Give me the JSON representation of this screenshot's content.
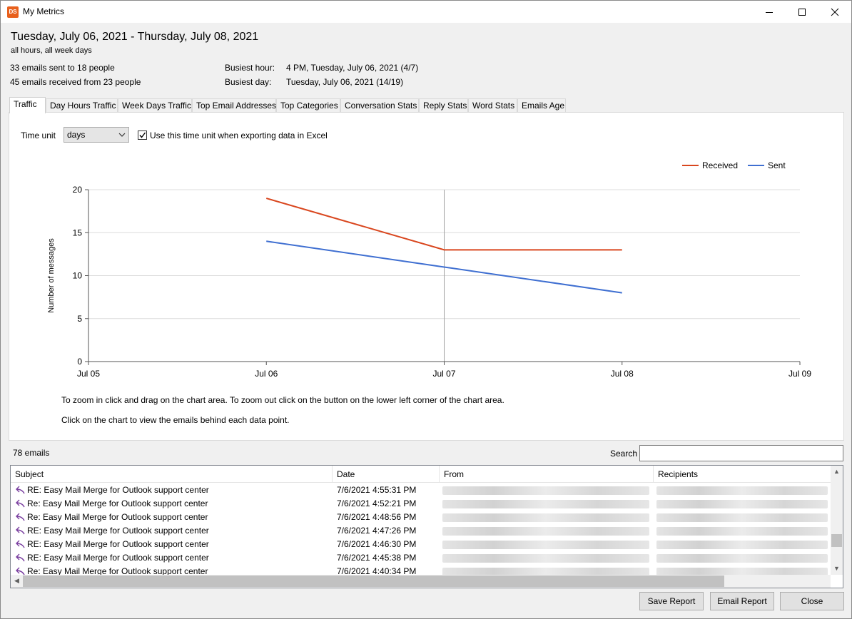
{
  "window": {
    "app_icon_text": "DS",
    "title": "My Metrics"
  },
  "header": {
    "date_range": "Tuesday, July 06, 2021 - Thursday, July 08, 2021",
    "filter": "all hours, all week days",
    "sent_summary": "33 emails sent to 18 people",
    "received_summary": "45 emails received from 23 people",
    "busiest_hour_label": "Busiest hour:",
    "busiest_hour_value": "4 PM, Tuesday, July 06, 2021 (4/7)",
    "busiest_day_label": "Busiest day:",
    "busiest_day_value": "Tuesday, July 06, 2021 (14/19)"
  },
  "tabs": [
    {
      "label": "Traffic",
      "active": true
    },
    {
      "label": "Day Hours Traffic",
      "active": false
    },
    {
      "label": "Week Days Traffic",
      "active": false
    },
    {
      "label": "Top Email Addresses",
      "active": false
    },
    {
      "label": "Top Categories",
      "active": false
    },
    {
      "label": "Conversation Stats",
      "active": false
    },
    {
      "label": "Reply Stats",
      "active": false
    },
    {
      "label": "Word Stats",
      "active": false
    },
    {
      "label": "Emails Age",
      "active": false
    }
  ],
  "traffic": {
    "time_unit_label": "Time unit",
    "time_unit_value": "days",
    "export_checkbox_label": "Use this time unit when exporting data in Excel",
    "export_checkbox_checked": true,
    "hint_zoom": "To zoom in click and drag on the chart area. To zoom out click on the button on the lower left corner of the chart area.",
    "hint_click": "Click on the chart to view the emails behind each data point."
  },
  "chart_data": {
    "type": "line",
    "x": [
      "Jul 06",
      "Jul 07",
      "Jul 08"
    ],
    "x_ticks": [
      "Jul 05",
      "Jul 06",
      "Jul 07",
      "Jul 08",
      "Jul 09"
    ],
    "ylabel": "Number of messages",
    "ylim": [
      0,
      20
    ],
    "y_ticks": [
      "0",
      "5",
      "10",
      "15",
      "20"
    ],
    "grid": true,
    "legend_position": "top-right",
    "series": [
      {
        "name": "Received",
        "color": "#d9461e",
        "values": [
          19,
          13,
          13
        ]
      },
      {
        "name": "Sent",
        "color": "#3f6fd1",
        "values": [
          14,
          11,
          8
        ]
      }
    ]
  },
  "emails": {
    "count_label": "78 emails",
    "search_label": "Search",
    "search_value": "",
    "columns": [
      "Subject",
      "Date",
      "From",
      "Recipients"
    ],
    "rows": [
      {
        "subject": "RE: Easy Mail Merge for Outlook support center",
        "date": "7/6/2021 4:55:31 PM"
      },
      {
        "subject": "Re: Easy Mail Merge for Outlook support center",
        "date": "7/6/2021 4:52:21 PM"
      },
      {
        "subject": "Re: Easy Mail Merge for Outlook support center",
        "date": "7/6/2021 4:48:56 PM"
      },
      {
        "subject": "RE: Easy Mail Merge for Outlook support center",
        "date": "7/6/2021 4:47:26 PM"
      },
      {
        "subject": "RE: Easy Mail Merge for Outlook support center",
        "date": "7/6/2021 4:46:30 PM"
      },
      {
        "subject": "RE: Easy Mail Merge for Outlook support center",
        "date": "7/6/2021 4:45:38 PM"
      },
      {
        "subject": "Re: Easy Mail Merge for Outlook support center",
        "date": "7/6/2021 4:40:34 PM"
      }
    ],
    "row_icon": "reply-arrow-icon"
  },
  "footer": {
    "save_label": "Save Report",
    "email_label": "Email Report",
    "close_label": "Close"
  }
}
